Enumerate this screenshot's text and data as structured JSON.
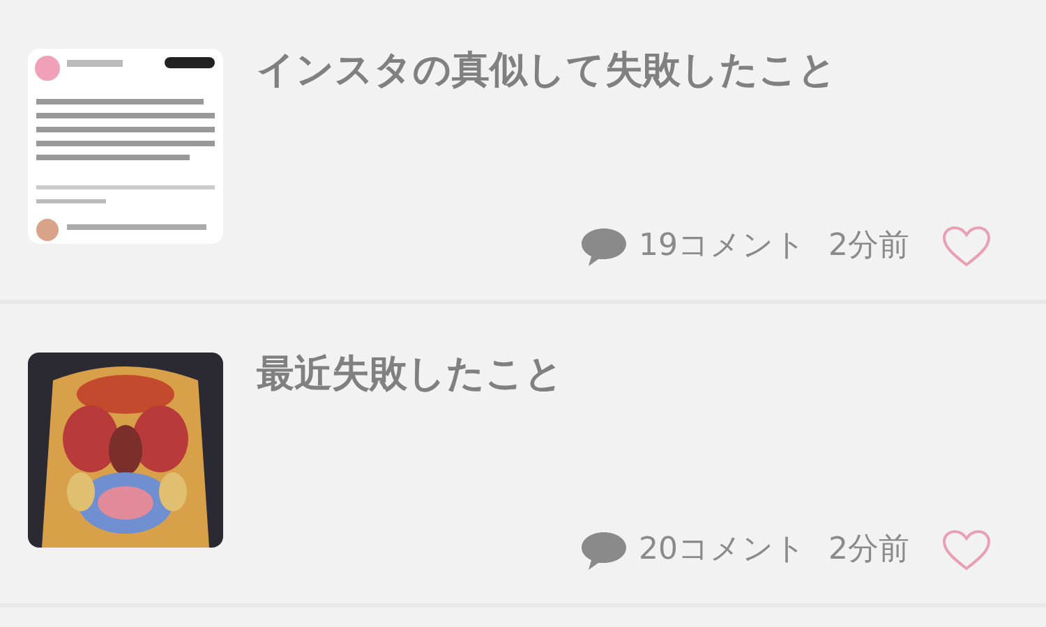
{
  "posts": [
    {
      "title": "インスタの真似して失敗したこと",
      "comments": "19コメント",
      "time": "2分前",
      "liked": false
    },
    {
      "title": "最近失敗したこと",
      "comments": "20コメント",
      "time": "2分前",
      "liked": false
    }
  ]
}
